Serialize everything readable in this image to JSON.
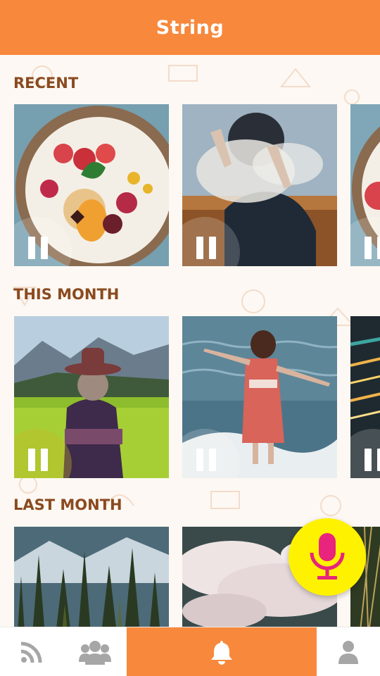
{
  "header": {
    "title": "String"
  },
  "sections": [
    {
      "title": "RECENT"
    },
    {
      "title": "THIS MONTH"
    },
    {
      "title": "LAST MONTH"
    }
  ],
  "colors": {
    "brand_orange": "#f7883c",
    "section_title": "#8a4a1f",
    "fab_yellow": "#fff200",
    "mic_pink": "#e8247c",
    "tab_icon_gray": "#a6a6a6"
  },
  "tabs": [
    {
      "icon": "rss-feed-icon",
      "active": false
    },
    {
      "icon": "group-icon",
      "active": false
    },
    {
      "icon": "bell-icon",
      "active": true
    },
    {
      "icon": "user-profile-icon",
      "active": false
    }
  ],
  "fab": {
    "icon": "microphone-icon"
  },
  "cards": {
    "recent": [
      {
        "image": "fruit-bowl-photo",
        "state": "playing"
      },
      {
        "image": "woman-in-dust-photo",
        "state": "playing"
      },
      {
        "image": "fruit-bowl-photo",
        "state": "playing"
      }
    ],
    "this_month": [
      {
        "image": "woman-in-hat-meadow-photo",
        "state": "playing"
      },
      {
        "image": "girl-at-sea-photo",
        "state": "playing"
      },
      {
        "image": "light-streaks-photo",
        "state": "playing"
      }
    ],
    "last_month": [
      {
        "image": "pine-forest-photo"
      },
      {
        "image": "clouds-aerial-photo"
      },
      {
        "image": "grass-photo"
      }
    ]
  }
}
